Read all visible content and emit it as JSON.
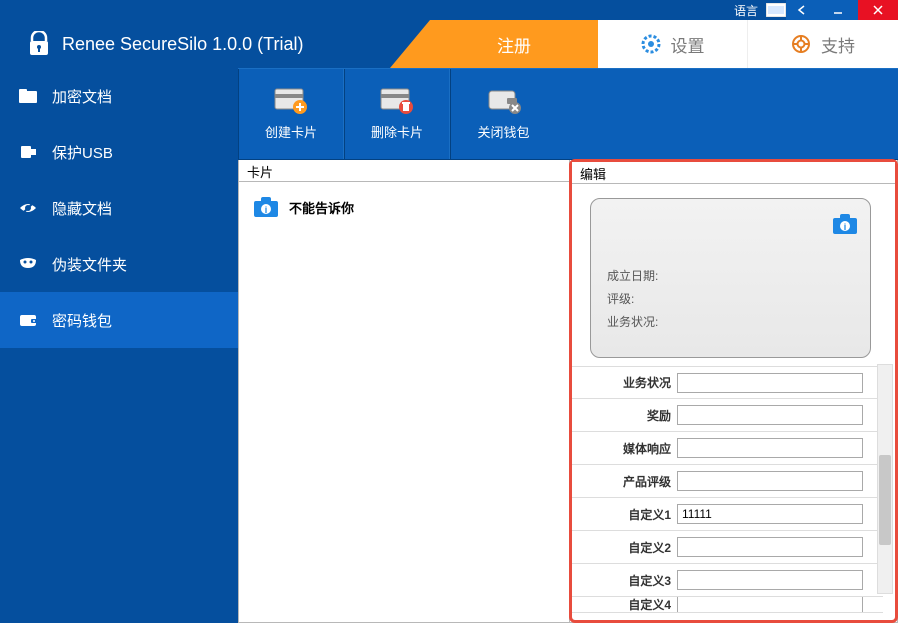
{
  "titlebar": {
    "language_label": "语言"
  },
  "app": {
    "title": "Renee SecureSilo 1.0.0 (Trial)"
  },
  "tabs": {
    "register": "注册",
    "settings": "设置",
    "support": "支持"
  },
  "sidebar": {
    "items": [
      {
        "label": "加密文档"
      },
      {
        "label": "保护USB"
      },
      {
        "label": "隐藏文档"
      },
      {
        "label": "伪装文件夹"
      },
      {
        "label": "密码钱包"
      }
    ]
  },
  "toolbar": {
    "create": "创建卡片",
    "delete": "删除卡片",
    "close": "关闭钱包"
  },
  "panels": {
    "card_header": "卡片",
    "edit_header": "编辑"
  },
  "card_list": {
    "item0": "不能告诉你"
  },
  "preview": {
    "f1_label": "成立日期:",
    "f2_label": "评级:",
    "f3_label": "业务状况:"
  },
  "form": {
    "rows": [
      {
        "label": "业务状况",
        "value": ""
      },
      {
        "label": "奖励",
        "value": ""
      },
      {
        "label": "媒体响应",
        "value": ""
      },
      {
        "label": "产品评级",
        "value": ""
      },
      {
        "label": "自定义1",
        "value": "11111"
      },
      {
        "label": "自定义2",
        "value": ""
      },
      {
        "label": "自定义3",
        "value": ""
      },
      {
        "label": "自定义4",
        "value": ""
      }
    ]
  }
}
